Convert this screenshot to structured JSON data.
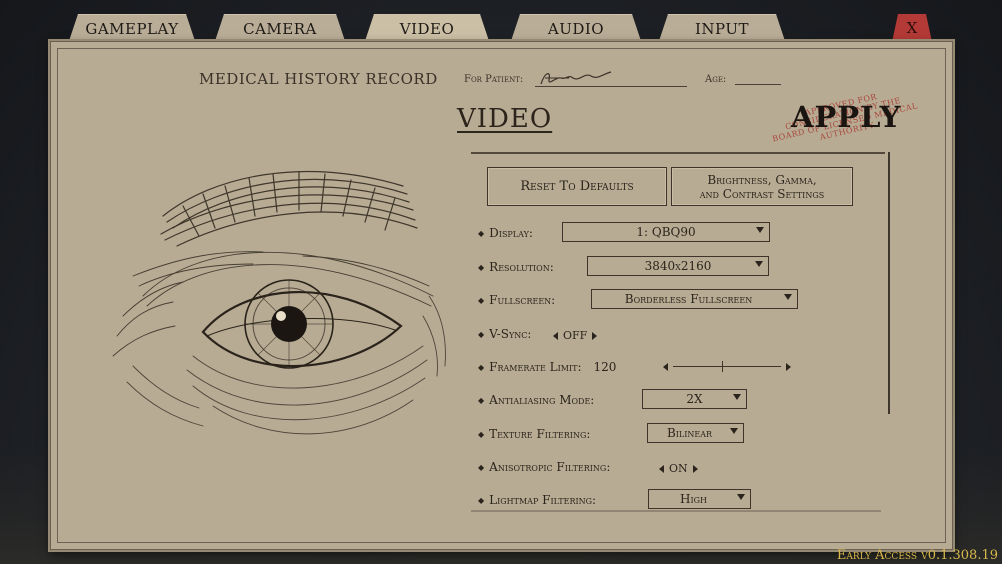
{
  "tabs": [
    {
      "label": "GAMEPLAY",
      "active": false
    },
    {
      "label": "CAMERA",
      "active": false
    },
    {
      "label": "VIDEO",
      "active": true
    },
    {
      "label": "AUDIO",
      "active": false
    },
    {
      "label": "INPUT",
      "active": false
    }
  ],
  "close_label": "X",
  "header": {
    "record_title": "MEDICAL HISTORY RECORD",
    "patient_label": "For Patient:",
    "age_label": "Age:"
  },
  "page_title": "VIDEO",
  "apply_label": "APPLY",
  "stamp_text": "APPROVED FOR CONSIDERATION BY THE BOARD OF LICENSED MEDICAL AUTHORITY",
  "buttons": {
    "reset": "Reset To Defaults",
    "bgc_line1": "Brightness, Gamma,",
    "bgc_line2": "and Contrast Settings"
  },
  "settings": {
    "display": {
      "label": "Display:",
      "value": "1: QBQ90"
    },
    "resolution": {
      "label": "Resolution:",
      "value": "3840x2160"
    },
    "fullscreen": {
      "label": "Fullscreen:",
      "value": "Borderless Fullscreen"
    },
    "vsync": {
      "label": "V-Sync:",
      "value": "OFF"
    },
    "framerate": {
      "label": "Framerate Limit:",
      "value": "120",
      "slider_fraction": 0.45
    },
    "antialiasing": {
      "label": "Antialiasing Mode:",
      "value": "2X"
    },
    "texture": {
      "label": "Texture Filtering:",
      "value": "Bilinear"
    },
    "anisotropic": {
      "label": "Anisotropic Filtering:",
      "value": "ON"
    },
    "lightmap": {
      "label": "Lightmap Filtering:",
      "value": "High"
    }
  },
  "version": "Early Access   v0.1.308.19",
  "colors": {
    "paper": "#b8ab93",
    "ink": "#2b241c",
    "stamp": "#a6362e",
    "close_tab": "#b33a36",
    "version_text": "#d8b84a"
  }
}
